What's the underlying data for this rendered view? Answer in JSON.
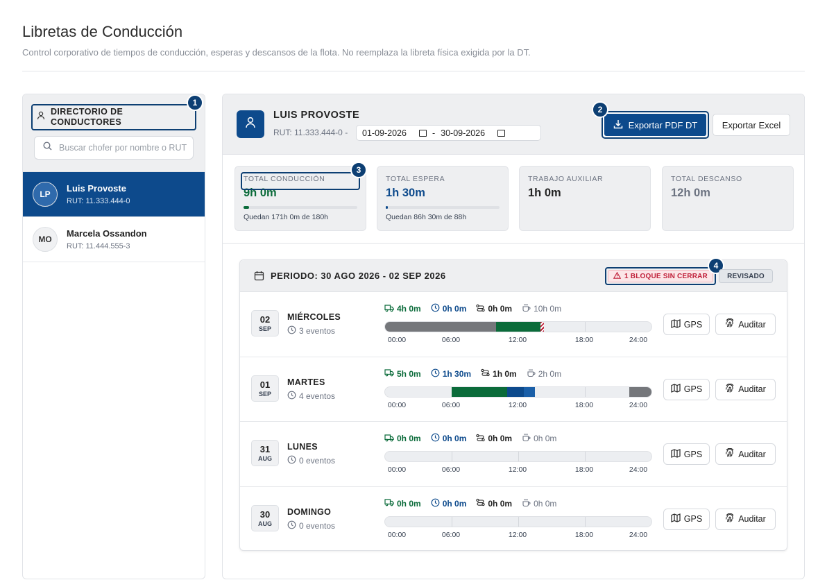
{
  "page": {
    "title": "Libretas de Conducción",
    "subtitle": "Control corporativo de tiempos de conducción, esperas y descansos de la flota. No reemplaza la libreta física exigida por la DT."
  },
  "sidebar": {
    "title": "DIRECTORIO DE CONDUCTORES",
    "badge": "1",
    "search_placeholder": "Buscar chofer por nombre o RUT",
    "drivers": [
      {
        "initials": "LP",
        "name": "Luis Provoste",
        "rut": "RUT: 11.333.444-0"
      },
      {
        "initials": "MO",
        "name": "Marcela Ossandon",
        "rut": "RUT: 11.444.555-3"
      }
    ]
  },
  "profile": {
    "name": "LUIS PROVOSTE",
    "rut": "RUT: 11.333.444-0",
    "sep1": "-",
    "date_from": "01-09-2026",
    "date_sep": "-",
    "date_to": "30-09-2026",
    "export_pdf": "Exportar PDF DT",
    "export_pdf_badge": "2",
    "export_excel": "Exportar Excel"
  },
  "stats": [
    {
      "label": "TOTAL CONDUCCIÓN",
      "value": "9h 0m",
      "remaining": "Quedan 171h 0m de 180h",
      "progress": 0.05,
      "color": "#0b6b3a",
      "badge": "3"
    },
    {
      "label": "TOTAL ESPERA",
      "value": "1h 30m",
      "remaining": "Quedan 86h 30m de 88h",
      "progress": 0.017,
      "color": "#0d4a8c"
    },
    {
      "label": "TRABAJO AUXILIAR",
      "value": "1h 0m",
      "color": "#222222"
    },
    {
      "label": "TOTAL DESCANSO",
      "value": "12h 0m",
      "color": "#6b7280"
    }
  ],
  "period": {
    "title": "PERIODO: 30 AGO 2026 - 02 SEP 2026",
    "warning": "1 BLOQUE SIN CERRAR",
    "warning_badge": "4",
    "status": "REVISADO",
    "ticks": [
      "00:00",
      "06:00",
      "12:00",
      "18:00",
      "24:00"
    ],
    "gps_label": "GPS",
    "audit_label": "Auditar",
    "days": [
      {
        "day": "02",
        "month": "SEP",
        "name": "MIÉRCOLES",
        "events": "3 eventos",
        "drive": "4h 0m",
        "wait": "0h 0m",
        "aux": "0h 0m",
        "rest": "10h 0m",
        "segments": [
          {
            "start": 0,
            "end": 10,
            "type": "rest"
          },
          {
            "start": 10,
            "end": 14,
            "type": "drive"
          },
          {
            "start": 14,
            "end": 14.3,
            "type": "open"
          }
        ]
      },
      {
        "day": "01",
        "month": "SEP",
        "name": "MARTES",
        "events": "4 eventos",
        "drive": "5h 0m",
        "wait": "1h 30m",
        "aux": "1h 0m",
        "rest": "2h 0m",
        "segments": [
          {
            "start": 6,
            "end": 11,
            "type": "drive"
          },
          {
            "start": 11,
            "end": 12.5,
            "type": "wait"
          },
          {
            "start": 12.5,
            "end": 13.5,
            "type": "wait2"
          },
          {
            "start": 22,
            "end": 24,
            "type": "rest"
          }
        ]
      },
      {
        "day": "31",
        "month": "AUG",
        "name": "LUNES",
        "events": "0 eventos",
        "drive": "0h 0m",
        "wait": "0h 0m",
        "aux": "0h 0m",
        "rest": "0h 0m",
        "segments": []
      },
      {
        "day": "30",
        "month": "AUG",
        "name": "DOMINGO",
        "events": "0 eventos",
        "drive": "0h 0m",
        "wait": "0h 0m",
        "aux": "0h 0m",
        "rest": "0h 0m",
        "segments": []
      }
    ]
  },
  "colors": {
    "drive": "#0b6b3a",
    "wait": "#0d4a8c",
    "wait2": "#1a5fa8",
    "aux": "#222222",
    "rest": "#75777b",
    "open": "#c0203a",
    "accent": "#0d4a8c"
  }
}
